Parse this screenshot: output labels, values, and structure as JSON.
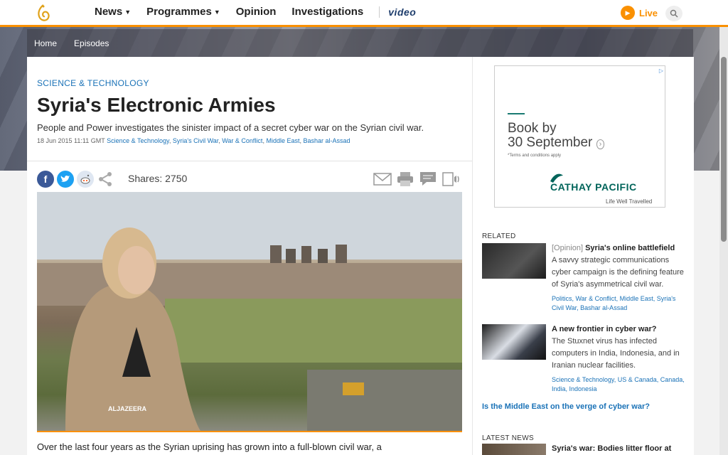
{
  "nav": {
    "items": [
      {
        "label": "News",
        "has_menu": true
      },
      {
        "label": "Programmes",
        "has_menu": true
      },
      {
        "label": "Opinion",
        "has_menu": false
      },
      {
        "label": "Investigations",
        "has_menu": false
      }
    ],
    "video_label": "video",
    "live_label": "Live",
    "accent": "#fa9000"
  },
  "subnav": {
    "home": "Home",
    "episodes": "Episodes"
  },
  "article": {
    "kicker": "SCIENCE & TECHNOLOGY",
    "title": "Syria's Electronic Armies",
    "dek": "People and Power investigates the sinister impact of a secret cyber war on the Syrian civil war.",
    "date": "18 Jun 2015 11:11 GMT",
    "tags": [
      "Science & Technology",
      "Syria's Civil War",
      "War & Conflict",
      "Middle East",
      "Bashar al-Assad"
    ],
    "shares": "Shares: 2750",
    "watermark": "ALJAZEERA",
    "body_start": "Over the last four years as the Syrian uprising has grown into a full-blown civil war, a"
  },
  "ad": {
    "headline_1": "Book by",
    "headline_2": "30 September",
    "terms": "*Terms and conditions apply",
    "brand": "CATHAY PACIFIC",
    "tagline": "Life Well Travelled"
  },
  "related": {
    "label": "RELATED",
    "items": [
      {
        "prefix": "[Opinion]",
        "title": "Syria's online battlefield",
        "desc": "A savvy strategic communications cyber campaign is the defining feature of Syria's asymmetrical civil war.",
        "tags": "Politics, War & Conflict, Middle East, Syria's Civil War, Bashar al-Assad"
      },
      {
        "prefix": "",
        "title": "A new frontier in cyber war?",
        "desc": "The Stuxnet virus has infected computers in India, Indonesia, and in Iranian nuclear facilities.",
        "tags": "Science & Technology, US & Canada, Canada, India, Indonesia"
      }
    ],
    "link": "Is the Middle East on the verge of cyber war?"
  },
  "latest": {
    "label": "LATEST NEWS",
    "item_title": "Syria's war: Bodies litter floor at"
  }
}
